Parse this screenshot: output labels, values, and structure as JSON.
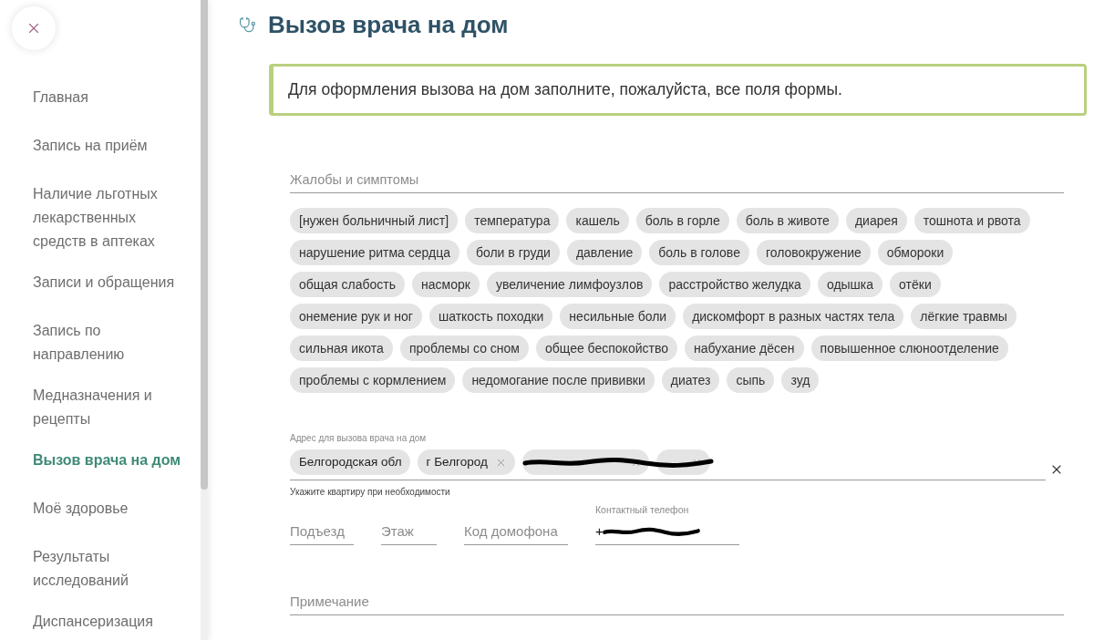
{
  "sidebar": {
    "items": [
      {
        "label": "Главная",
        "selected": false
      },
      {
        "label": "Запись на приём",
        "selected": false
      },
      {
        "label": "Наличие льготных лекарственных средств в аптеках",
        "selected": false
      },
      {
        "label": "Записи и обращения",
        "selected": false
      },
      {
        "label": "Запись по направлению",
        "selected": false
      },
      {
        "label": "Медназначения и рецепты",
        "selected": false
      },
      {
        "label": "Вызов врача на дом",
        "selected": true
      },
      {
        "label": "Моё здоровье",
        "selected": false
      },
      {
        "label": "Результаты исследований",
        "selected": false
      },
      {
        "label": "Диспансеризация",
        "selected": false
      }
    ]
  },
  "page": {
    "title": "Вызов врача на дом",
    "notice": "Для оформления вызова на дом заполните, пожалуйста, все поля формы."
  },
  "complaints": {
    "placeholder": "Жалобы и симптомы",
    "symptoms": [
      {
        "label": "[нужен больничный лист]",
        "selected": false
      },
      {
        "label": "температура",
        "selected": false
      },
      {
        "label": "кашель",
        "selected": false
      },
      {
        "label": "боль в горле",
        "selected": false
      },
      {
        "label": "боль в животе",
        "selected": false
      },
      {
        "label": "диарея",
        "selected": false
      },
      {
        "label": "тошнота и рвота",
        "selected": false
      },
      {
        "label": "нарушение ритма сердца",
        "selected": false
      },
      {
        "label": "боли в груди",
        "selected": false
      },
      {
        "label": "давление",
        "selected": false
      },
      {
        "label": "боль в голове",
        "selected": false
      },
      {
        "label": "головокружение",
        "selected": false
      },
      {
        "label": "обмороки",
        "selected": false
      },
      {
        "label": "общая слабость",
        "selected": false
      },
      {
        "label": "насморк",
        "selected": false
      },
      {
        "label": "увеличение лимфоузлов",
        "selected": false
      },
      {
        "label": "расстройство желудка",
        "selected": false
      },
      {
        "label": "одышка",
        "selected": false
      },
      {
        "label": "отёки",
        "selected": false
      },
      {
        "label": "онемение рук и ног",
        "selected": false
      },
      {
        "label": "шаткость походки",
        "selected": false
      },
      {
        "label": "несильные боли",
        "selected": false
      },
      {
        "label": "дискомфорт в разных частях тела",
        "selected": false
      },
      {
        "label": "лёгкие травмы",
        "selected": false
      },
      {
        "label": "сильная икота",
        "selected": false
      },
      {
        "label": "проблемы со сном",
        "selected": false
      },
      {
        "label": "общее беспокойство",
        "selected": false
      },
      {
        "label": "набухание дёсен",
        "selected": false
      },
      {
        "label": "повышенное слюноотделение",
        "selected": false
      },
      {
        "label": "проблемы с кормлением",
        "selected": false
      },
      {
        "label": "недомогание после прививки",
        "selected": false
      },
      {
        "label": "диатез",
        "selected": false
      },
      {
        "label": "сыпь",
        "selected": false
      },
      {
        "label": "зуд",
        "selected": false
      }
    ]
  },
  "address": {
    "label": "Адрес для вызова врача на дом",
    "chips": [
      {
        "label": "Белгородская обл",
        "removable": false,
        "redacted": false
      },
      {
        "label": "г Белгород",
        "removable": true,
        "redacted": false
      },
      {
        "removable": true,
        "redacted": true
      },
      {
        "removable": true,
        "redacted": true
      }
    ],
    "hint": "Укажите квартиру при необходимости"
  },
  "details": {
    "fields": [
      {
        "placeholder": "Подъезд"
      },
      {
        "placeholder": "Этаж"
      },
      {
        "placeholder": "Код домофона"
      },
      {
        "label": "Контактный телефон",
        "value": "+",
        "redacted": true
      }
    ]
  },
  "note": {
    "placeholder": "Примечание"
  }
}
